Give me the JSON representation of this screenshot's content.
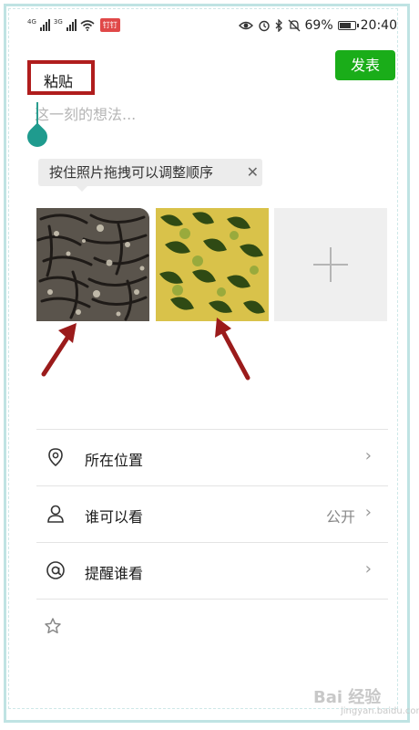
{
  "status_bar": {
    "signal1": "4G",
    "signal2": "3G",
    "app_badge": "钉钉",
    "battery_percent": "69%",
    "time": "20:40"
  },
  "toolbar": {
    "paste_label": "粘贴",
    "publish_label": "发表"
  },
  "post": {
    "placeholder": "这一刻的想法..."
  },
  "tooltip": {
    "text": "按住照片拖拽可以调整顺序",
    "close_icon": "close-icon"
  },
  "photos": [
    "photo-1",
    "photo-2"
  ],
  "menu": {
    "items": [
      {
        "label": "所在位置",
        "value": "",
        "icon": "location-icon"
      },
      {
        "label": "谁可以看",
        "value": "公开",
        "icon": "person-icon"
      },
      {
        "label": "提醒谁看",
        "value": "",
        "icon": "at-icon"
      }
    ]
  },
  "watermark": {
    "text": "Bai 经验",
    "sub": "jingyan.baidu.com"
  },
  "colors": {
    "accent_green": "#1aad19",
    "highlight_red": "#b01d1d",
    "caret_teal": "#1f9b8e"
  }
}
